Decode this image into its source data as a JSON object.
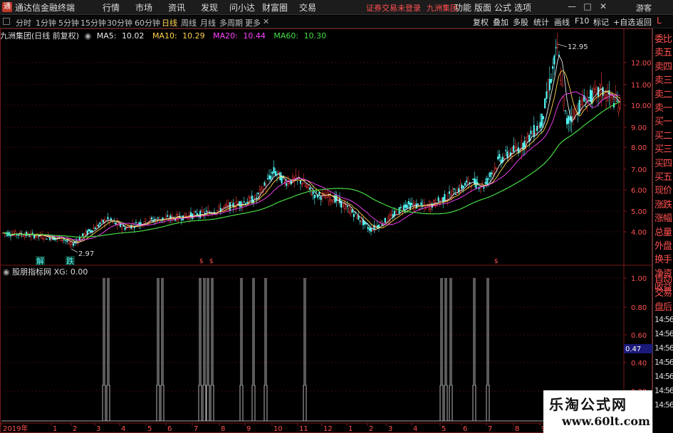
{
  "app": {
    "title": "通达信金融终端",
    "menu": [
      "行情",
      "市场",
      "资讯",
      "发现",
      "问小达",
      "财富圈",
      "交易"
    ],
    "notice": "证券交易未登录",
    "broker": "九洲集团",
    "right_menu": [
      "功能",
      "版面",
      "公式",
      "选项"
    ],
    "guest": "游客",
    "window_buttons": [
      "—",
      "□",
      "✕"
    ]
  },
  "period_bar": {
    "tabs": [
      "分时",
      "1分钟",
      "5分钟",
      "15分钟",
      "30分钟",
      "60分钟",
      "日线",
      "周线",
      "月线",
      "多周期",
      "更多"
    ],
    "active": "日线",
    "right_buttons": [
      "复权",
      "叠加",
      "多股",
      "统计",
      "画线",
      "F10",
      "标记",
      "+自选",
      "返回"
    ]
  },
  "main_chart": {
    "title": "九洲集团(日线 前复权)",
    "ma": [
      {
        "label": "MA5:",
        "value": "10.02",
        "color": "#e8e8e8"
      },
      {
        "label": "MA10:",
        "value": "10.29",
        "color": "#ffd24d"
      },
      {
        "label": "MA20:",
        "value": "10.44",
        "color": "#ff44ff"
      },
      {
        "label": "MA60:",
        "value": "10.30",
        "color": "#44dd44"
      }
    ],
    "y_ticks": [
      "12.00",
      "11.00",
      "10.00",
      "9.00",
      "8.00",
      "7.00",
      "6.00",
      "5.00",
      "4.00"
    ],
    "high_label": "12.95",
    "low_label": "2.97",
    "markers": [
      "解",
      "跌"
    ]
  },
  "sub_chart": {
    "title": "股朋指标网 XG: 0.00",
    "y_ticks": [
      "1.00",
      "0.80",
      "0.60",
      "0.40",
      "0.20"
    ],
    "current_value": "0.47"
  },
  "x_axis": {
    "labels": [
      "2019年",
      "1",
      "2",
      "3",
      "4",
      "5",
      "6",
      "7",
      "8",
      "9",
      "10",
      "11",
      "12",
      "1",
      "2",
      "3",
      "4",
      "5",
      "6",
      "7",
      "8",
      "9"
    ]
  },
  "right_panel": {
    "letter": "L",
    "items": [
      "委比",
      "卖五",
      "卖四",
      "卖三",
      "卖二",
      "卖一",
      "买一",
      "买二",
      "买三",
      "买四",
      "买五",
      "现价",
      "涨跌",
      "涨幅",
      "总量",
      "外盘",
      "换手",
      "净资",
      "收益",
      "自动",
      "交易",
      "盘后",
      "14:56",
      "14:56",
      "14:56",
      "14:56",
      "14:56",
      "14:56",
      "14:56"
    ]
  },
  "watermark": {
    "line1": "乐淘公式网",
    "line2": "www.60lt.com"
  },
  "colors": {
    "up": "#ff3b3b",
    "down": "#54fcfc",
    "ma5": "#e8e8e8",
    "ma10": "#ffd24d",
    "ma20": "#ff44ff",
    "ma60": "#44dd44",
    "signal": "#e0e0e0",
    "grid": "#7a1a1a"
  }
}
